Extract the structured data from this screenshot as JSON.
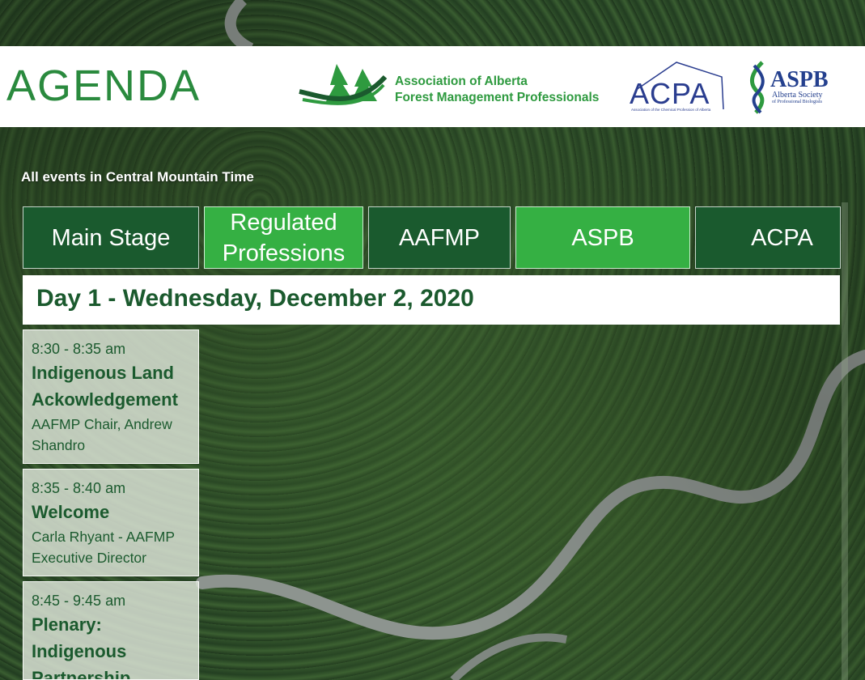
{
  "header": {
    "title": "AGENDA",
    "logos": {
      "aafmp": {
        "line1": "Association of Alberta",
        "line2": "Forest Management Professionals"
      },
      "acpa": {
        "word": "ACPA",
        "subtitle": "Association of the Chemical Profession of Alberta"
      },
      "aspb": {
        "word": "ASPB",
        "subtitle_line1": "Alberta Society",
        "subtitle_line2": "of Professional Biologists"
      }
    }
  },
  "timezone_note": "All events in Central Mountain Time",
  "tabs": [
    {
      "label": "Main Stage",
      "style": "dark"
    },
    {
      "label_line1": "Regulated",
      "label_line2": "Professions",
      "style": "light"
    },
    {
      "label": "AAFMP",
      "style": "dark"
    },
    {
      "label": "ASPB",
      "style": "light"
    },
    {
      "label": "ACPA",
      "style": "dark"
    }
  ],
  "day": {
    "heading": "Day 1 - Wednesday, December 2, 2020"
  },
  "sessions": [
    {
      "time": "8:30 - 8:35 am",
      "title_line1": "Indigenous Land",
      "title_line2": "Ackowledgement",
      "speaker_line1": "AAFMP Chair, Andrew",
      "speaker_line2": "Shandro"
    },
    {
      "time": "8:35 - 8:40 am",
      "title_line1": "Welcome",
      "speaker_line1": "Carla Rhyant - AAFMP",
      "speaker_line2": "Executive Director"
    },
    {
      "time": "8:45 - 9:45 am",
      "title_line1": "Plenary:",
      "title_line2": "Indigenous",
      "title_line3": "Partnership"
    }
  ],
  "colors": {
    "brand_green": "#2a8a3e",
    "dark_tab": "#1a5a2e",
    "light_tab": "#35b043",
    "heading_text": "#1b5a2e",
    "partner_blue": "#2a3d8f"
  }
}
